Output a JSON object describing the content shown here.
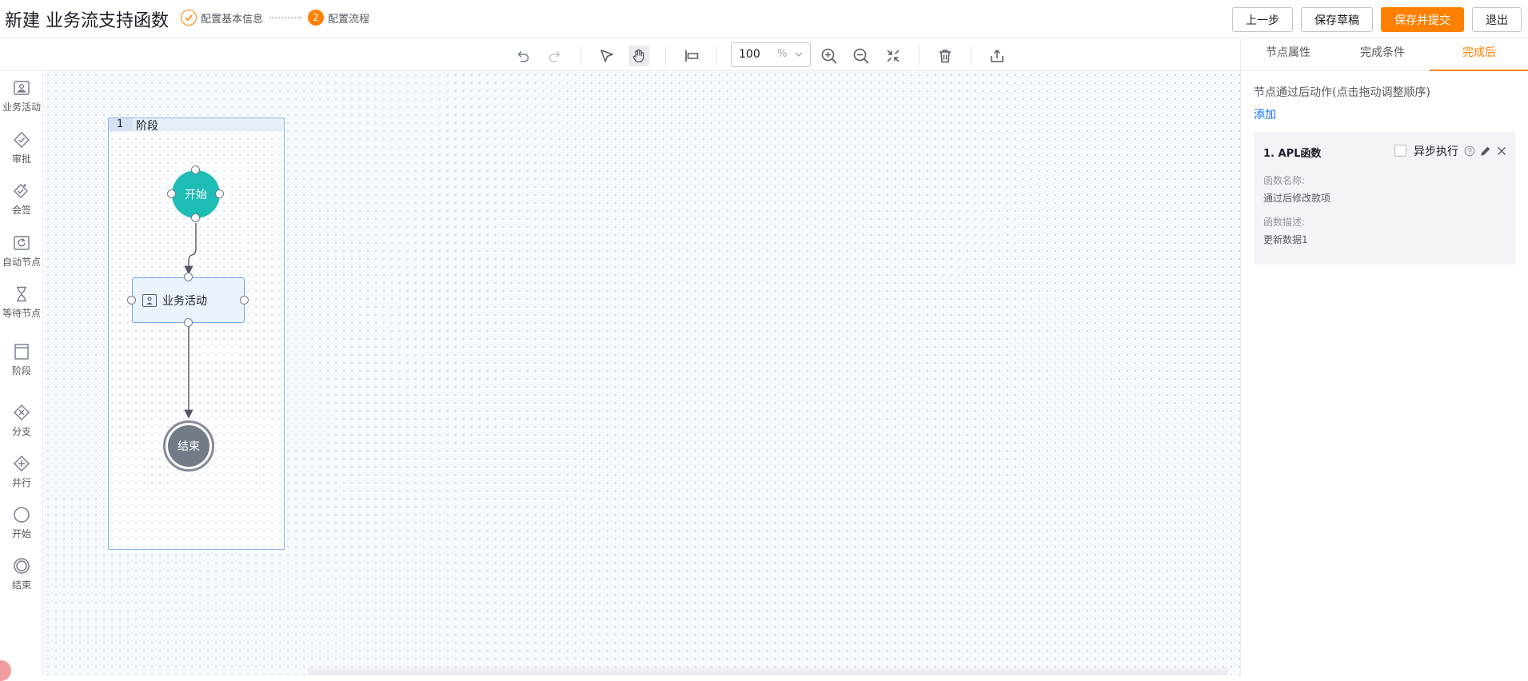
{
  "header": {
    "title": "新建 业务流支持函数",
    "steps": [
      {
        "label": "配置基本信息",
        "status": "done"
      },
      {
        "label": "配置流程",
        "status": "current",
        "number": "2"
      }
    ],
    "buttons": {
      "prev": "上一步",
      "save_draft": "保存草稿",
      "save_submit": "保存并提交",
      "exit": "退出"
    },
    "accent_color": "#ff8000"
  },
  "toolbar": {
    "zoom_value": "100",
    "zoom_unit": "%",
    "tools": [
      "undo-icon",
      "redo-icon",
      "select-arrow-icon",
      "hand-pan-icon",
      "align-left-icon",
      "zoom-in-icon",
      "zoom-out-icon",
      "fit-screen-icon",
      "delete-icon",
      "export-icon"
    ]
  },
  "palette": {
    "items": [
      {
        "label": "业务活动",
        "icon": "business-activity-icon"
      },
      {
        "label": "审批",
        "icon": "approval-icon"
      },
      {
        "label": "会签",
        "icon": "countersign-icon"
      },
      {
        "label": "自动节点",
        "icon": "auto-node-icon"
      },
      {
        "label": "等待节点",
        "icon": "hourglass-icon"
      },
      {
        "label": "阶段",
        "icon": "stage-icon"
      },
      {
        "label": "分支",
        "icon": "branch-icon"
      },
      {
        "label": "并行",
        "icon": "parallel-icon"
      },
      {
        "label": "开始",
        "icon": "start-circle-icon"
      },
      {
        "label": "结束",
        "icon": "end-circle-icon"
      }
    ]
  },
  "canvas": {
    "lane": {
      "number": "1",
      "name": "阶段"
    },
    "start_node": "开始",
    "task_node": "业务活动",
    "end_node": "结束",
    "start_color": "#1dbcb5",
    "end_color": "#737b88"
  },
  "panel": {
    "tabs": [
      {
        "label": "节点属性",
        "active": false
      },
      {
        "label": "完成条件",
        "active": false
      },
      {
        "label": "完成后",
        "active": true
      }
    ],
    "description": "节点通过后动作(点击拖动调整顺序)",
    "add_link": "添加",
    "card": {
      "title": "1. APL函数",
      "async_label": "异步执行",
      "async_checked": false,
      "fields": [
        {
          "label": "函数名称:",
          "value": "通过后修改款项"
        },
        {
          "label": "函数描述:",
          "value": "更新数据1"
        }
      ]
    }
  }
}
